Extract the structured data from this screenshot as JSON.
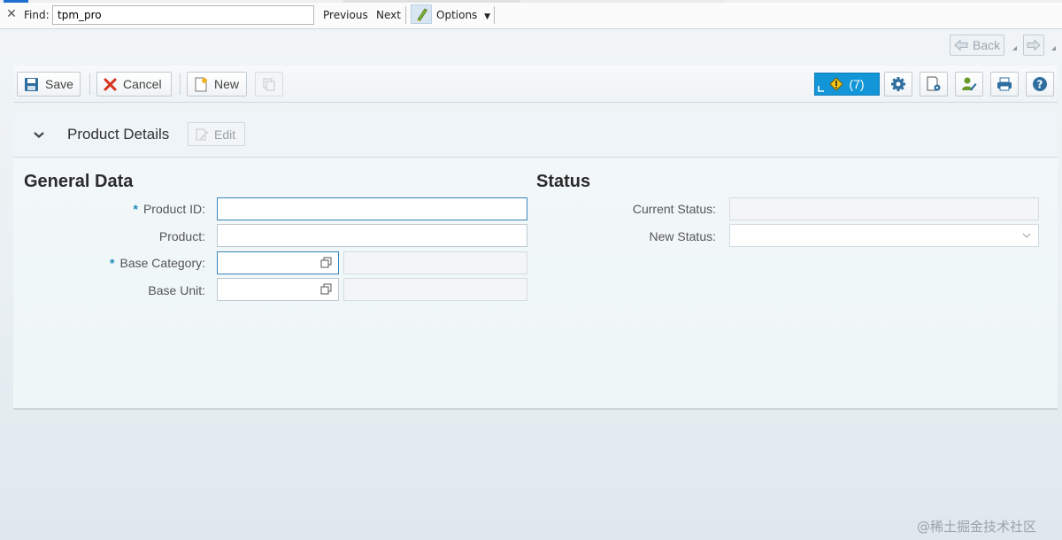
{
  "findbar": {
    "label": "Find:",
    "query": "tpm_pro",
    "previous": "Previous",
    "next": "Next",
    "options": "Options",
    "close_icon": "close-icon",
    "highlight_icon": "pencil-icon"
  },
  "nav": {
    "back": "Back"
  },
  "toolbar": {
    "save": "Save",
    "cancel": "Cancel",
    "new": "New",
    "messages_count": "(7)",
    "accent": "#1296d8"
  },
  "panel": {
    "title": "Product Details",
    "edit": "Edit"
  },
  "general": {
    "heading": "General Data",
    "fields": {
      "product_id": {
        "label": "Product ID:",
        "value": "",
        "required": "*"
      },
      "product": {
        "label": "Product:",
        "value": ""
      },
      "base_category": {
        "label": "Base Category:",
        "value": "",
        "description": "",
        "required": "*"
      },
      "base_unit": {
        "label": "Base Unit:",
        "value": "",
        "description": ""
      }
    }
  },
  "status": {
    "heading": "Status",
    "current_label": "Current Status:",
    "current_value": "",
    "new_label": "New Status:",
    "new_value": ""
  },
  "watermark": "@稀土掘金技术社区"
}
